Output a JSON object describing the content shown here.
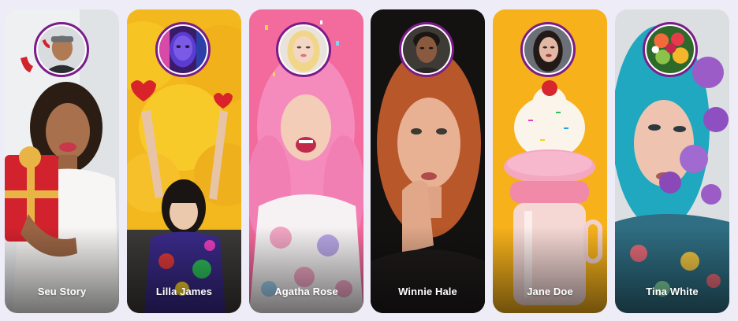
{
  "stories": [
    {
      "name": "Seu Story",
      "image": "woman-with-gift-photo",
      "avatar": "man-with-antlers-avatar"
    },
    {
      "name": "Lilla James",
      "image": "girl-with-yellow-balloons-photo",
      "avatar": "neon-face-avatar"
    },
    {
      "name": "Agatha Rose",
      "image": "pink-haired-woman-photo",
      "avatar": "blonde-woman-avatar"
    },
    {
      "name": "Winnie Hale",
      "image": "redhead-woman-photo",
      "avatar": "young-man-avatar"
    },
    {
      "name": "Jane Doe",
      "image": "milkshake-donut-photo",
      "avatar": "dark-haired-woman-avatar"
    },
    {
      "name": "Tina White",
      "image": "blue-haired-woman-flowers-photo",
      "avatar": "fruit-bowl-avatar"
    }
  ],
  "colors": {
    "avatar_ring": "#7b1c8a",
    "page_background": "#eeedf7",
    "label": "#ffffff"
  }
}
